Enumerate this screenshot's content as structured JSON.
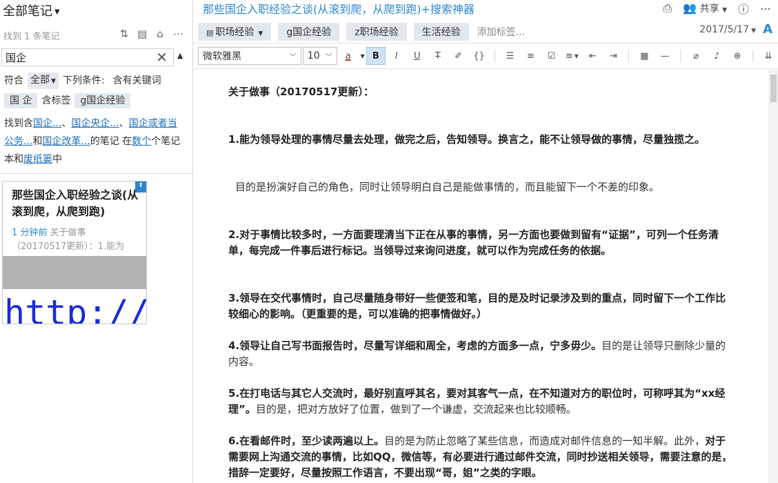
{
  "left_panel": {
    "title": "全部笔记",
    "count": "找到 1 条笔记",
    "tools": [
      "sort-icon",
      "view-icon",
      "lock-icon",
      "more-icon"
    ],
    "search_value": "国企",
    "filter": {
      "match_label": "符合",
      "match_value": "全部",
      "conditions_label": "下列条件:",
      "keyword_label": "含有关键词",
      "keyword_value": "国 企",
      "tag_label": "含标签",
      "tag_value": "g国企经验"
    },
    "found": {
      "prefix": "找到含",
      "links": [
        "国企...",
        "国企央企...",
        "国企或者当公务...",
        "国企改革..."
      ],
      "comma1": "、",
      "comma2": "、",
      "and": "和",
      "mid": "的笔记 在",
      "link_notebooks": "数个",
      "mid2": "个笔记本和",
      "link_trash": "废纸篓",
      "suffix": "中"
    },
    "card": {
      "title": "那些国企入职经验之谈(从滚到爬，从爬到跑)",
      "time": "1 分钟前",
      "snippet": " 关于做事（20170517更新）：1.能为",
      "thumb_text": "http://"
    }
  },
  "doc": {
    "title": "那些国企入职经验之谈(从滚到爬，从爬到跑)+搜索神器",
    "share_label": "共享",
    "tags": [
      {
        "label": "职场经验",
        "notebook": true
      },
      {
        "label": "g国企经验"
      },
      {
        "label": "z职场经验"
      },
      {
        "label": "生活经验"
      }
    ],
    "add_tag": "添加标签...",
    "date": "2017/5/17",
    "font_btn": "A",
    "toolbar": {
      "font": "微软雅黑",
      "size": "10",
      "color_letter": "a",
      "bold": "B",
      "italic": "I",
      "underline": "U",
      "strike": "T",
      "eraser": "✐",
      "code": "{}"
    },
    "content": {
      "heading": "关于做事（20170517更新）：",
      "p1_bold": "1.能为领导处理的事情尽量去处理，做完之后，告知领导。换言之，能不让领导做的事情，尽量独揽之。",
      "p1_note": "目的是扮演好自己的角色，同时让领导明白自己是能做事情的，而且能留下一个不差的印象。",
      "p2_bold": "2.对于事情比较多时，一方面要理清当下正在从事的事情，另一方面也要做到留有“证据”，可列一个任务清单，每完成一件事后进行标记。当领导过来询问进度，就可以作为完成任务的依据。",
      "p3_bold": "3.领导在交代事情时，自己尽量随身带好一些便签和笔，目的是及时记录涉及到的重点，同时留下一个工作比较细心的影响。（更重要的是，可以准确的把事情做好。）",
      "p4_bold": "4.领导让自己写书面报告时，尽量写详细和周全，考虑的方面多一点，宁多毋少。",
      "p4_normal": "目的是让领导只删除少量的内容。",
      "p5_bold": "5.在打电话与其它人交流时，最好别直呼其名，要对其客气一点，在不知道对方的职位时，可称呼其为“xx经理”。",
      "p5_normal": "目的是，把对方放好了位置，做到了一个谦虚，交流起来也比较顺畅。",
      "p6_bold": "6.在看邮件时，至少读两遍以上。",
      "p6_normal": "目的是为防止忽略了某些信息，而造成对邮件信息的一知半解。此外，",
      "p6_bold2": "对于需要网上沟通交流的事情，比如QQ，微信等，有必要进行通过邮件交流，同时抄送相关领导，需要注意的是，措辞一定要好，尽量按照工作语言，不要出现“哥，姐”之类的字眼。"
    }
  }
}
